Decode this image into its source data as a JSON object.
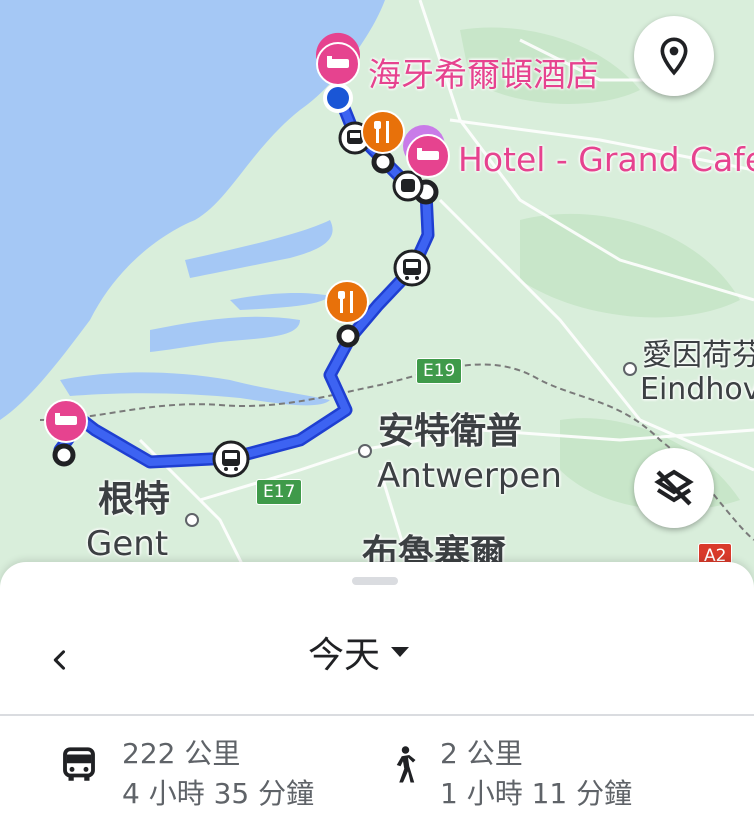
{
  "map": {
    "hotel_labels": [
      "海牙希爾頓酒店",
      "Hotel - Grand Cafe"
    ],
    "city_labels": {
      "antwerp_cjk": "安特衛普",
      "antwerp_latin": "Antwerpen",
      "gent_cjk": "根特",
      "gent_latin": "Gent",
      "brussels_cjk": "布魯塞爾",
      "eindhoven_cjk": "愛因荷芬",
      "eindhoven_latin": "Eindhov"
    },
    "road_shields": [
      "E19",
      "E17",
      "A2"
    ],
    "icons": [
      "hotel-icon",
      "restaurant-icon",
      "bus-icon",
      "location-pin-icon",
      "layers-off-icon"
    ]
  },
  "sheet": {
    "date_selector": "今天",
    "transit": {
      "distance": "222 公里",
      "duration": "4 小時 35 分鐘"
    },
    "walking": {
      "distance": "2 公里",
      "duration": "1 小時 11 分鐘"
    }
  },
  "colors": {
    "route": "#2b4fe0",
    "hotel_marker": "#e6438f",
    "restaurant_marker": "#e8710a",
    "sea": "#a5c8f5",
    "land": "#d9eedb"
  }
}
